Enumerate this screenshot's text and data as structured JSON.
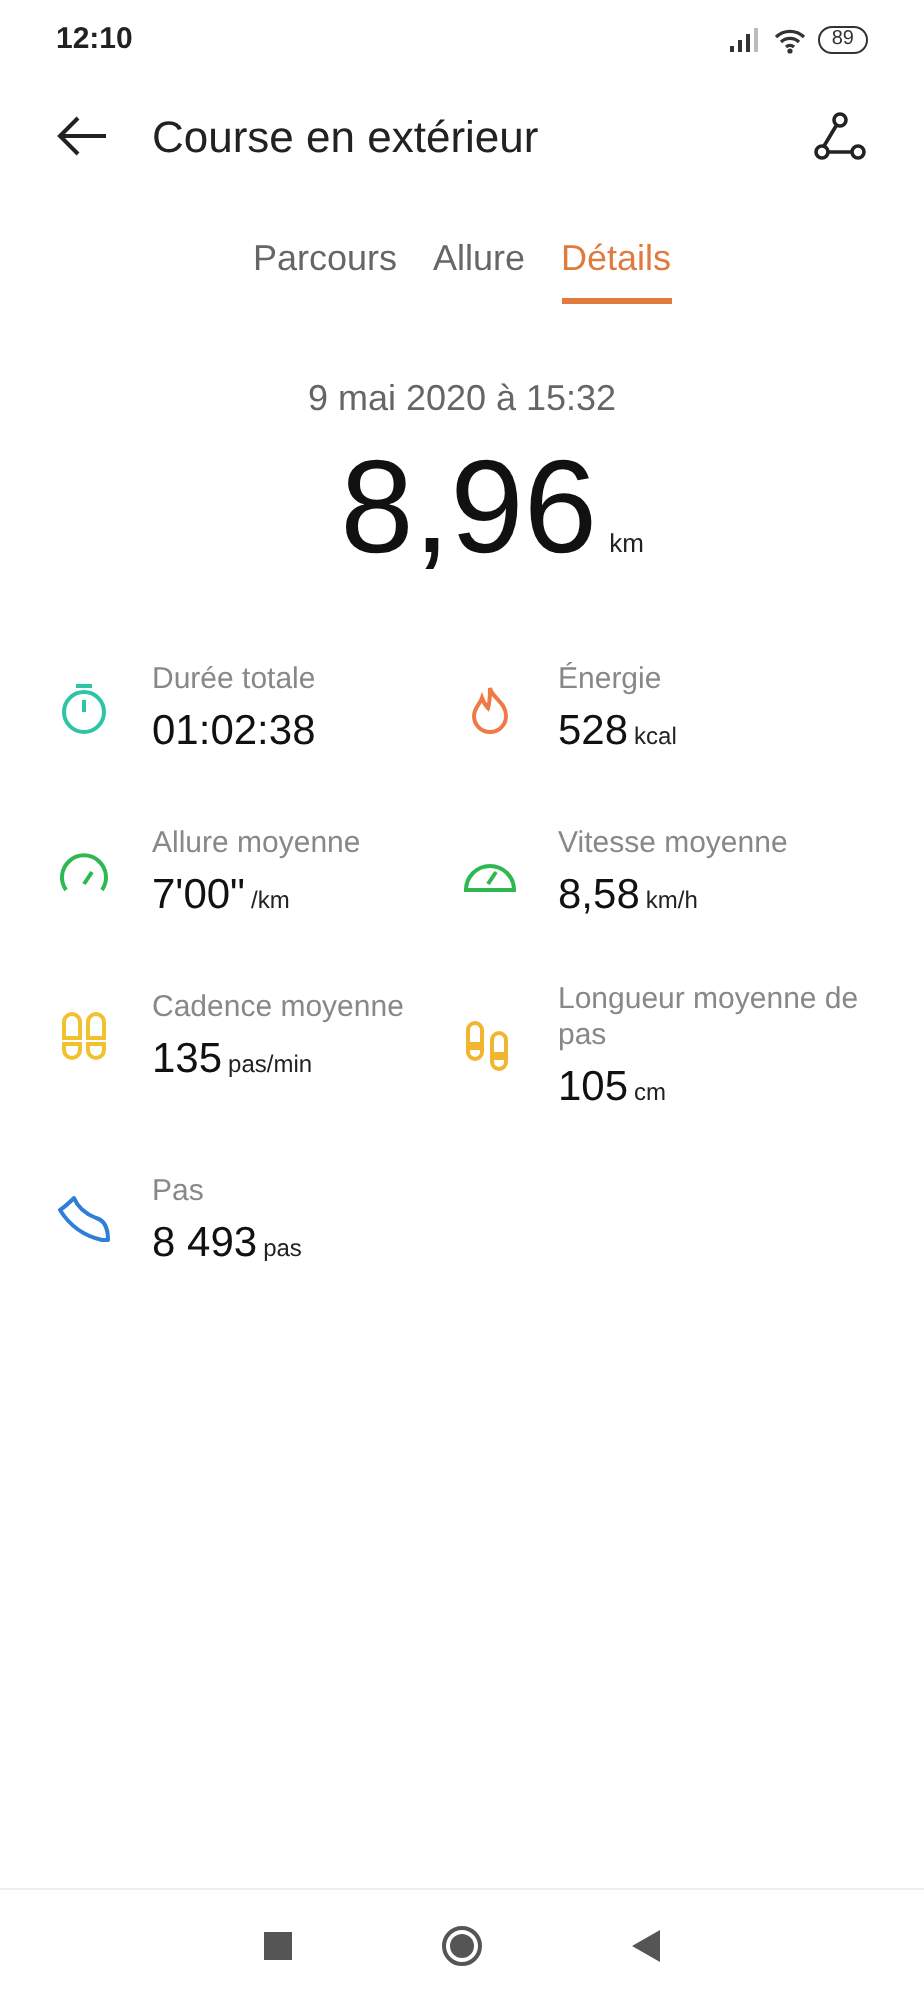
{
  "status_bar": {
    "time": "12:10",
    "battery": "89"
  },
  "header": {
    "title": "Course en extérieur"
  },
  "tabs": [
    {
      "label": "Parcours",
      "selected": false
    },
    {
      "label": "Allure",
      "selected": false
    },
    {
      "label": "Détails",
      "selected": true
    }
  ],
  "summary": {
    "date": "9 mai 2020 à 15:32",
    "distance": "8,96",
    "unit": "km"
  },
  "metrics": [
    {
      "kind": "stopwatch",
      "color": "#2ec4a6",
      "label": "Durée totale",
      "value": "01:02:38"
    },
    {
      "kind": "flame",
      "color": "#f07a45",
      "label": "Énergie",
      "value": "528",
      "unit": "kcal"
    },
    {
      "kind": "gauge",
      "color": "#2eb84f",
      "label": "Allure moyenne",
      "value": "7'00\"",
      "unit": "/km"
    },
    {
      "kind": "speedometer",
      "color": "#2eb84f",
      "label": "Vitesse moyenne",
      "value": "8,58",
      "unit": "km/h"
    },
    {
      "kind": "footprints",
      "color": "#f2c12e",
      "label": "Cadence moyenne",
      "value": "135",
      "unit": "pas/min"
    },
    {
      "kind": "steps",
      "color": "#f2b52e",
      "label": "Longueur moyenne de pas",
      "value": "105",
      "unit": "cm"
    },
    {
      "kind": "shoe",
      "color": "#2f7fd6",
      "label": "Pas",
      "value": "8 493",
      "unit": "pas"
    }
  ]
}
